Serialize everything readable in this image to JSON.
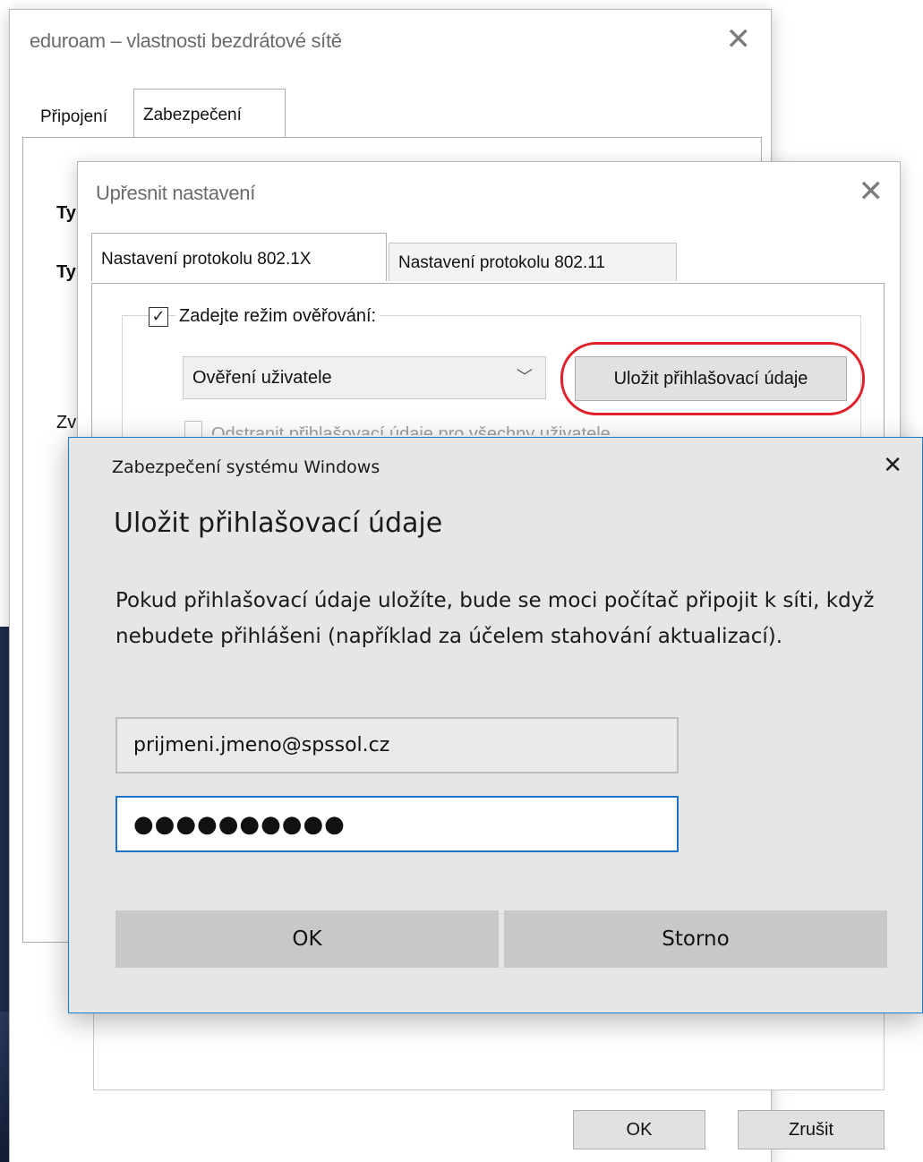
{
  "eduroam_window": {
    "title": "eduroam – vlastnosti bezdrátové sítě",
    "tabs": [
      {
        "label": "Připojení"
      },
      {
        "label": "Zabezpečení"
      }
    ],
    "stub_labels": [
      "Ty",
      "Ty",
      "Zv"
    ],
    "ok_label": "OK",
    "cancel_label": "Zrušit"
  },
  "advanced_window": {
    "title": "Upřesnit nastavení",
    "tabs": [
      {
        "label": "Nastavení protokolu 802.1X"
      },
      {
        "label": "Nastavení protokolu 802.11"
      }
    ],
    "auth_mode_checkbox_label": "Zadejte režim ověřování:",
    "auth_mode_checked": true,
    "auth_mode_value": "Ověření uživatele",
    "save_credentials_button": "Uložit přihlašovací údaje",
    "remove_credentials_label": "Odstranit přihlašovací údaje pro všechny uživatele"
  },
  "security_dialog": {
    "caption": "Zabezpečení systému Windows",
    "heading": "Uložit přihlašovací údaje",
    "body": "Pokud přihlašovací údaje uložíte, bude se moci počítač připojit k síti, když nebudete přihlášeni (například za účelem stahování aktualizací).",
    "username_value": "prijmeni.jmeno@spssol.cz",
    "password_masked": "●●●●●●●●●●",
    "ok_label": "OK",
    "cancel_label": "Storno"
  },
  "colors": {
    "highlight_ring": "#e0202a",
    "focus_border": "#1a73c8"
  },
  "icons": {
    "close": "close-icon",
    "checkmark": "checkmark-icon",
    "dropdown": "chevron-down-icon"
  }
}
